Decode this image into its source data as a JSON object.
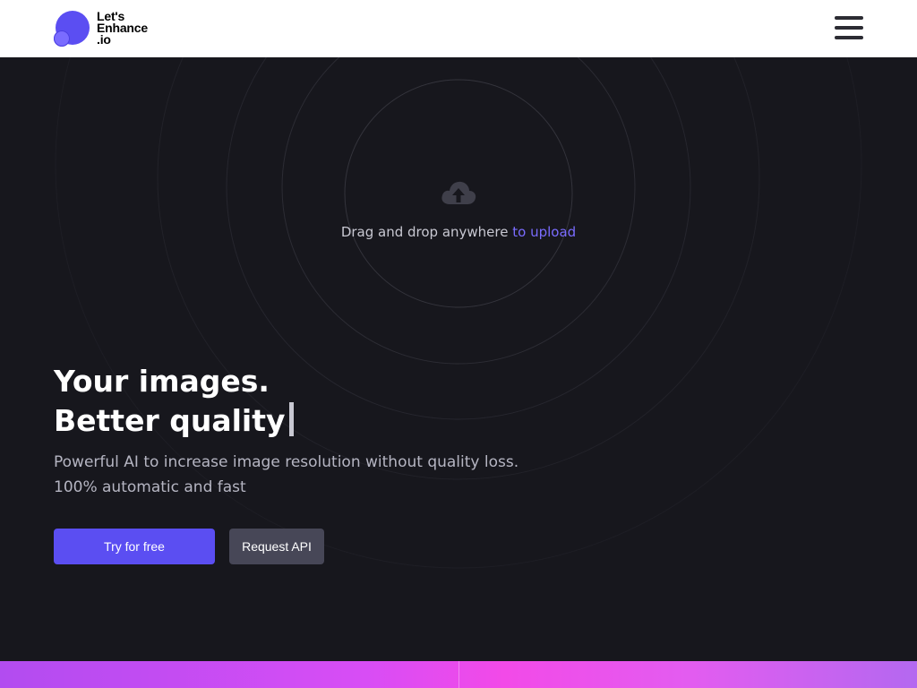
{
  "brand": {
    "logo_lines": [
      "Let's",
      "Enhance",
      ".io"
    ]
  },
  "upload": {
    "text": "Drag and drop anywhere",
    "link": "to upload",
    "icon": "cloud-upload-icon"
  },
  "hero": {
    "headline_line1": "Your images.",
    "headline_line2": "Better quality",
    "subtitle_line1": "Powerful AI to increase image resolution without quality loss.",
    "subtitle_line2": "100% automatic and fast"
  },
  "buttons": {
    "primary": "Try for free",
    "secondary": "Request API"
  },
  "colors": {
    "accent": "#5b4ef2",
    "background": "#17171d",
    "secondary_button": "#474757",
    "link": "#7a6cff"
  }
}
